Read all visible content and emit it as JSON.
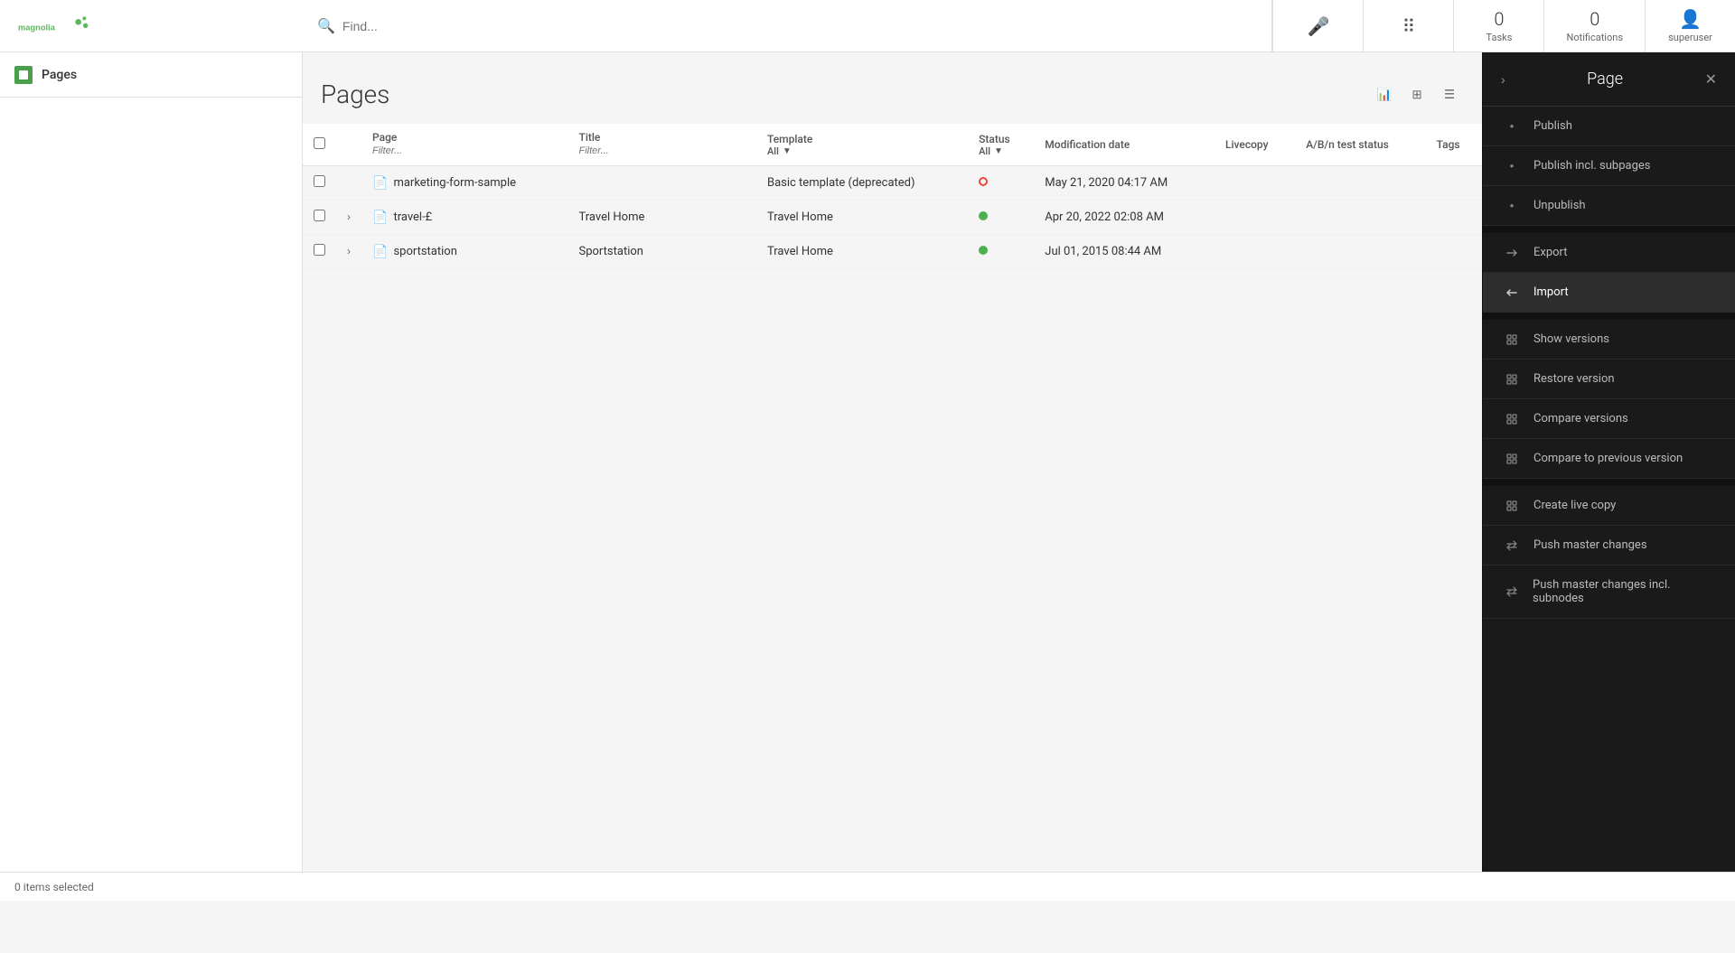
{
  "app": {
    "title": "Magnolia CMS"
  },
  "topnav": {
    "search_placeholder": "Find...",
    "tasks_count": "0",
    "tasks_label": "Tasks",
    "notifications_count": "0",
    "notifications_label": "Notifications",
    "user_label": "superuser"
  },
  "sidebar": {
    "icon_label": "pages-icon",
    "title": "Pages"
  },
  "pages": {
    "title": "Pages",
    "columns": [
      "Page",
      "Title",
      "Template",
      "Status",
      "Modification date",
      "Livecopy",
      "A/B/n test status",
      "Tags"
    ],
    "filters": [
      "Filter...",
      "Filter...",
      "",
      "All",
      ""
    ],
    "rows": [
      {
        "name": "marketing-form-sample",
        "title": "",
        "template": "Basic template (deprecated)",
        "status": "inactive",
        "modification_date": "May 21, 2020 04:17 AM",
        "livecopy": "",
        "ab_test": "",
        "tags": "",
        "expandable": false
      },
      {
        "name": "travel-£",
        "title": "Travel Home",
        "template": "Travel Home",
        "status": "active",
        "modification_date": "Apr 20, 2022 02:08 AM",
        "livecopy": "",
        "ab_test": "",
        "tags": "",
        "expandable": true
      },
      {
        "name": "sportstation",
        "title": "Sportstation",
        "template": "Travel Home",
        "status": "active",
        "modification_date": "Jul 01, 2015 08:44 AM",
        "livecopy": "",
        "ab_test": "",
        "tags": "",
        "expandable": true
      }
    ]
  },
  "right_panel": {
    "title": "Page",
    "items": [
      {
        "id": "publish",
        "label": "Publish",
        "icon": "●"
      },
      {
        "id": "publish-incl-subpages",
        "label": "Publish incl. subpages",
        "icon": "●"
      },
      {
        "id": "unpublish",
        "label": "Unpublish",
        "icon": "●"
      },
      {
        "id": "export",
        "label": "Export",
        "icon": "→"
      },
      {
        "id": "import",
        "label": "Import",
        "icon": "→",
        "active": true
      },
      {
        "id": "show-versions",
        "label": "Show versions",
        "icon": "⊞"
      },
      {
        "id": "restore-version",
        "label": "Restore version",
        "icon": "⊞"
      },
      {
        "id": "compare-versions",
        "label": "Compare versions",
        "icon": "⊞"
      },
      {
        "id": "compare-previous",
        "label": "Compare to previous version",
        "icon": "⊞"
      },
      {
        "id": "create-live-copy",
        "label": "Create live copy",
        "icon": "⊞"
      },
      {
        "id": "push-master-changes",
        "label": "Push master changes",
        "icon": "⇄"
      },
      {
        "id": "push-master-changes-subnodes",
        "label": "Push master changes incl. subnodes",
        "icon": "⇄"
      }
    ]
  },
  "status_bar": {
    "text": "0 items selected"
  }
}
